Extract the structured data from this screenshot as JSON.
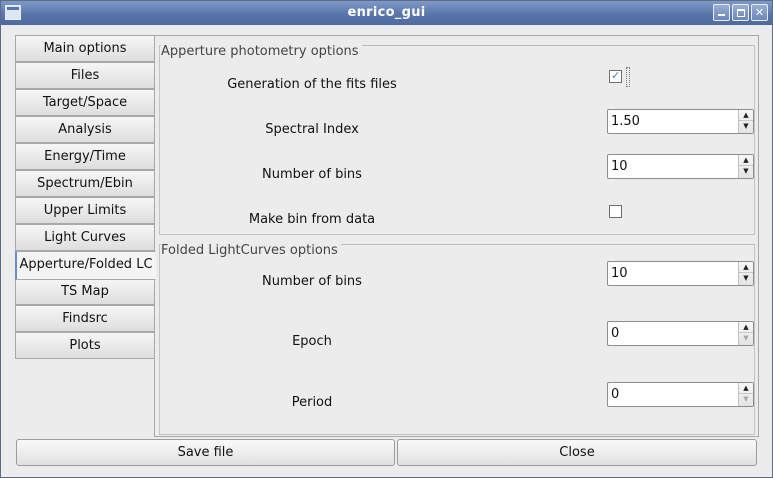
{
  "window": {
    "title": "enrico_gui",
    "icons": {
      "app": "window-icon",
      "minimize": "minimize-icon",
      "maximize": "maximize-icon",
      "close": "close-icon"
    },
    "close_glyph": "✕"
  },
  "tabs": [
    {
      "label": "Main options",
      "active": false
    },
    {
      "label": "Files",
      "active": false
    },
    {
      "label": "Target/Space",
      "active": false
    },
    {
      "label": "Analysis",
      "active": false
    },
    {
      "label": "Energy/Time",
      "active": false
    },
    {
      "label": "Spectrum/Ebin",
      "active": false
    },
    {
      "label": "Upper Limits",
      "active": false
    },
    {
      "label": "Light Curves",
      "active": false
    },
    {
      "label": "Apperture/Folded LC",
      "active": true
    },
    {
      "label": "TS Map",
      "active": false
    },
    {
      "label": "Findsrc",
      "active": false
    },
    {
      "label": "Plots",
      "active": false
    }
  ],
  "aperture_group": {
    "title": "Apperture photometry options",
    "fits_label": "Generation of the fits files",
    "fits_checked": true,
    "check_glyph": "✓",
    "spectral_index_label": "Spectral Index",
    "spectral_index_value": "1.50",
    "nbins_label": "Number of bins",
    "nbins_value": "10",
    "bin_from_data_label": "Make bin from data",
    "bin_from_data_checked": false
  },
  "folded_group": {
    "title": "Folded LightCurves options",
    "nbins_label": "Number of bins",
    "nbins_value": "10",
    "epoch_label": "Epoch",
    "epoch_value": "0",
    "period_label": "Period",
    "period_value": "0"
  },
  "spin_arrows": {
    "up": "▲",
    "down": "▼"
  },
  "buttons": {
    "save": "Save file",
    "close": "Close"
  }
}
